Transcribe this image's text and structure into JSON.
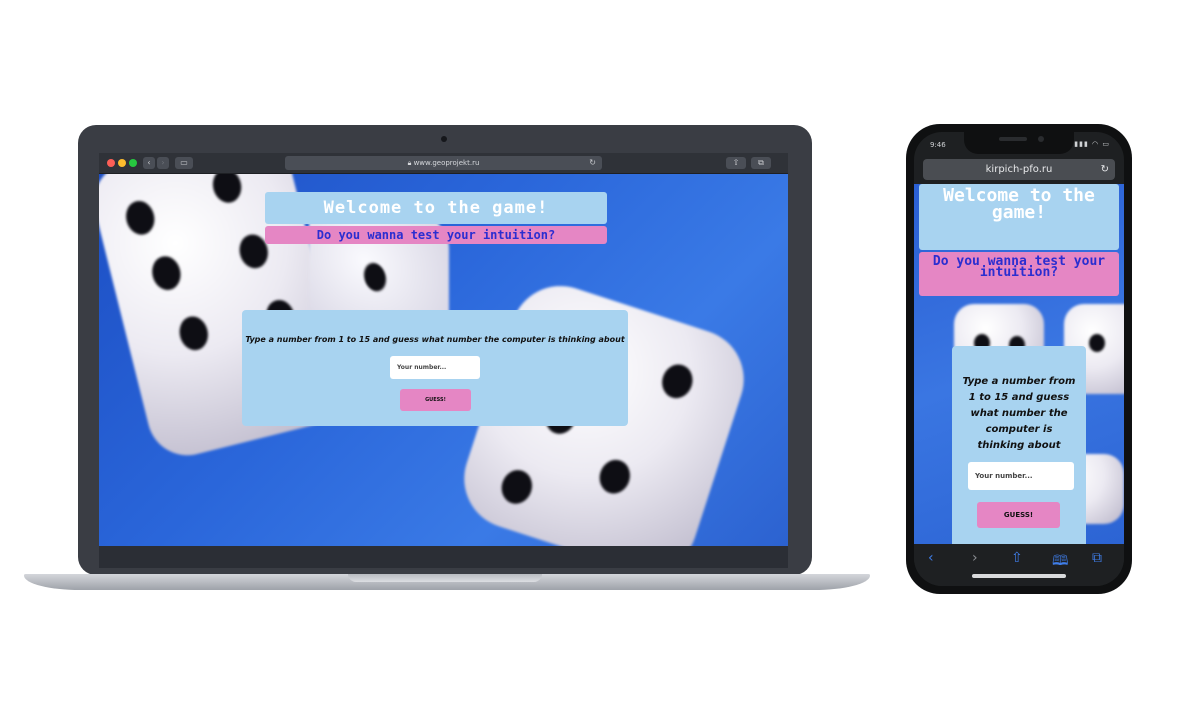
{
  "laptop": {
    "browser": {
      "url": "www.geoprojekt.ru",
      "lock_icon": "lock-icon",
      "reload_icon": "reload-icon",
      "back_icon": "chevron-left-icon",
      "forward_icon": "chevron-right-icon",
      "sidebar_icon": "sidebar-icon",
      "share_icon": "share-icon",
      "tabs_icon": "tabs-icon"
    },
    "page": {
      "title": "Welcome to the game!",
      "subtitle": "Do you wanna test your intuition?",
      "prompt": "Type a number from 1 to 15 and guess what number the computer is thinking about",
      "input_placeholder": "Your number...",
      "button_label": "GUESS!"
    }
  },
  "phone": {
    "status": {
      "time": "9:46"
    },
    "browser": {
      "url": "kirpich-pfo.ru"
    },
    "page": {
      "title": "Welcome to the game!",
      "subtitle": "Do you wanna test your intuition?",
      "prompt": "Type a number from 1 to 15 and guess what number the computer is thinking about",
      "input_placeholder": "Your number...",
      "button_label": "GUESS!"
    },
    "toolbar": [
      "chevron-left-icon",
      "chevron-right-icon",
      "share-icon",
      "bookmarks-icon",
      "tabs-icon"
    ]
  },
  "colors": {
    "title_box": "#a8d3f0",
    "subtitle_box": "#e586c4",
    "subtitle_text": "#2b2ed0",
    "card": "#a8d3f0",
    "button": "#e586c4",
    "background_blue": "#2a66da"
  }
}
